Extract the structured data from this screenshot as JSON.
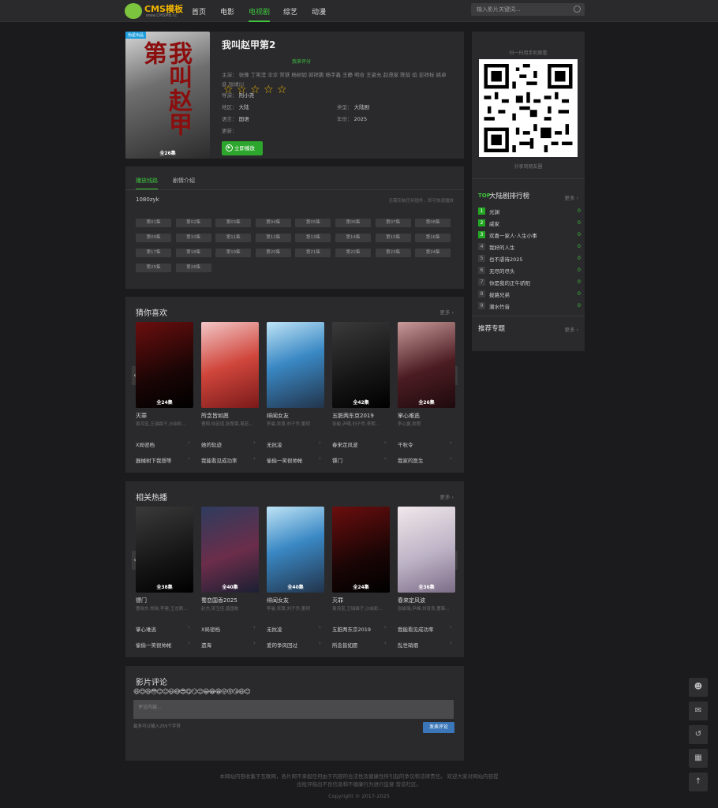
{
  "site": {
    "logo_text": "CMS模板",
    "logo_sub": "www.CMSMB.cc"
  },
  "nav": [
    "首页",
    "电影",
    "电视剧",
    "综艺",
    "动漫"
  ],
  "nav_active_index": 2,
  "search": {
    "placeholder": "输入影片关键词..."
  },
  "detail": {
    "poster_tag": "伪星出品",
    "poster_label": "全26集",
    "title": "我叫赵甲第2",
    "rating_link": "我来评分",
    "stars": 5,
    "cast_label": "主演：",
    "cast": [
      "张豫",
      "丁笑滢",
      "伞伞",
      "常铁",
      "杨树如",
      "郭祥鹏",
      "杨宇鑫",
      "王静",
      "明合",
      "王姿允",
      "赵茂家",
      "陈琰",
      "焰",
      "彭祥标",
      "姚卓音",
      "张靖川"
    ],
    "director_label": "导演：",
    "director": "刑小尧",
    "region_label": "地区：",
    "region": "大陆",
    "type_label": "类型：",
    "type": "大陆剧",
    "lang_label": "语言：",
    "lang": "国语",
    "year_label": "年份：",
    "year": "2025",
    "update_label": "更新：",
    "update": "",
    "play_button": "立即播放"
  },
  "play": {
    "tabs": [
      "播放线路",
      "剧情介绍"
    ],
    "source": "1080zyk",
    "hint": "无需安装任何插件，即可快速播放",
    "episodes": [
      "第01集",
      "第02集",
      "第03集",
      "第04集",
      "第05集",
      "第06集",
      "第07集",
      "第08集",
      "第09集",
      "第10集",
      "第11集",
      "第12集",
      "第13集",
      "第14集",
      "第15集",
      "第16集",
      "第17集",
      "第18集",
      "第19集",
      "第20集",
      "第21集",
      "第22集",
      "第23集",
      "第24集",
      "第25集",
      "第26集"
    ]
  },
  "guess": {
    "title": "猜你喜欢",
    "more": "更多",
    "cards": [
      {
        "title": "灭罪",
        "sub": "袁鸿宝,王瑞霖子,沙启彩...",
        "label": "全24集"
      },
      {
        "title": "所念皆如愿",
        "sub": "曹翔,徐若瑄,张楚嵩,周若...",
        "label": ""
      },
      {
        "title": "绯闻女友",
        "sub": "李晨,吴尊,刘子乔,董玥",
        "label": ""
      },
      {
        "title": "五脏两东京2019",
        "sub": "张峻,尹啸,刘子乔,李熙...",
        "label": "全42集"
      },
      {
        "title": "掌心难逃",
        "sub": "李心露,尚程",
        "label": "全26集"
      }
    ],
    "links": [
      [
        "X局密档",
        "她的轨迹",
        "无抗凌",
        "春来定风波",
        "千秋令"
      ],
      [
        "器械树下我想等",
        "我能看见成功率",
        "偷偷一笑很帅帐",
        "镖门",
        "我家的医生"
      ]
    ]
  },
  "related": {
    "title": "相关热播",
    "more": "更多",
    "cards": [
      {
        "title": "镖门",
        "sub": "曹晓东,常晓,李建,王志刚...",
        "label": "全38集"
      },
      {
        "title": "蜀恋国香2025",
        "sub": "赵杰,宋玉佳,曾国栋",
        "label": "全40集"
      },
      {
        "title": "绯闻女友",
        "sub": "李晨,吴尊,刘子乔,董玥",
        "label": "全40集"
      },
      {
        "title": "灭罪",
        "sub": "袁鸿宝,王瑞霖子,沙启彩...",
        "label": "全24集"
      },
      {
        "title": "春来定风波",
        "sub": "张峻瑞,尹峰,刘育良,曹韩...",
        "label": "全36集"
      }
    ],
    "links": [
      [
        "掌心难逃",
        "X局密档",
        "无抗凌",
        "五脏两东京2019",
        "我能看见成功率"
      ],
      [
        "偷偷一笑很帅帐",
        "遗海",
        "爱的争风回过",
        "所念皆如愿",
        "乱世硝烟"
      ]
    ]
  },
  "comment": {
    "title": "影片评论",
    "emojis": "😄😍😆😳😊😉😃😅😎😋😏😌😀😂😁😜😝😘😆😊",
    "placeholder": "评论内容...",
    "limit": "最多可以输入255个字符",
    "submit": "发表评论"
  },
  "sidebar": {
    "qr_caption": "扫一扫用手机观看",
    "share": "分享到朋友圈",
    "rank_badge": "TOP",
    "rank_title": "大陆剧排行榜",
    "more": "更多",
    "rank": [
      {
        "n": "1",
        "name": "光渊",
        "c": "0"
      },
      {
        "n": "2",
        "name": "威家",
        "c": "0"
      },
      {
        "n": "3",
        "name": "欢喜一家人·人生小事",
        "c": "0"
      },
      {
        "n": "4",
        "name": "我好的人生",
        "c": "0"
      },
      {
        "n": "5",
        "name": "也不虐待2025",
        "c": "0"
      },
      {
        "n": "6",
        "name": "无尽的尽头",
        "c": "0"
      },
      {
        "n": "7",
        "name": "你是我的正午骄阳",
        "c": "0"
      },
      {
        "n": "8",
        "name": "拔路兄弟",
        "c": "0"
      },
      {
        "n": "9",
        "name": "潮水竹音",
        "c": "0"
      }
    ],
    "topic_title": "推荐专题"
  },
  "footer": {
    "line1": "本网站内容收集于互联网，各片网不承担任何由于内容的合法性及健康性所引起的争议和法律责任。 欢迎大家对网站内容提",
    "line2": "出批评指出不良信息和不健康行为进行监督 营造社区。",
    "copyright": "Copyright © 2017-2025"
  }
}
